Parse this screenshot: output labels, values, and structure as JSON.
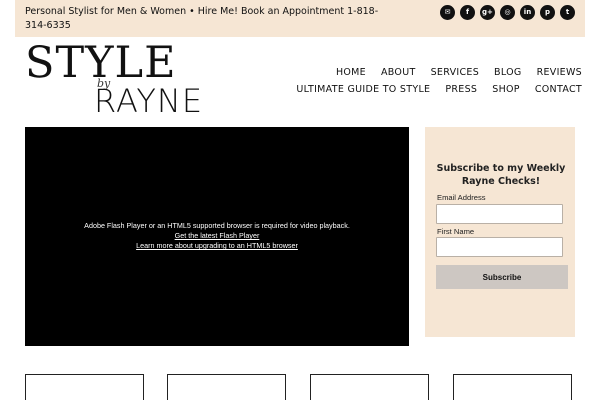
{
  "topbar": {
    "text": "Personal Stylist for Men & Women • Hire Me! Book an Appointment 1-818-314-6335",
    "social": [
      {
        "icon": "email-icon",
        "glyph": "✉"
      },
      {
        "icon": "facebook-icon",
        "glyph": "f"
      },
      {
        "icon": "google-plus-icon",
        "glyph": "g+"
      },
      {
        "icon": "instagram-icon",
        "glyph": "◎"
      },
      {
        "icon": "linkedin-icon",
        "glyph": "in"
      },
      {
        "icon": "pinterest-icon",
        "glyph": "p"
      },
      {
        "icon": "twitter-icon",
        "glyph": "t"
      }
    ]
  },
  "logo": {
    "line1": "STYLE",
    "line2": "by",
    "line3": "RAYNE"
  },
  "nav": {
    "row1": [
      "HOME",
      "ABOUT",
      "SERVICES",
      "BLOG",
      "REVIEWS"
    ],
    "row2": [
      "ULTIMATE GUIDE TO STYLE",
      "PRESS",
      "SHOP",
      "CONTACT"
    ]
  },
  "video": {
    "message": "Adobe Flash Player or an HTML5 supported browser is required for video playback.",
    "link1": "Get the latest Flash Player",
    "link2": "Learn more about upgrading to an HTML5 browser"
  },
  "subscribe": {
    "title": "Subscribe to my Weekly Rayne Checks!",
    "email_label": "Email Address",
    "email_value": "",
    "name_label": "First Name",
    "name_value": "",
    "button": "Subscribe"
  },
  "colors": {
    "accent_beige": "#f6e6d4",
    "button_gray": "#cdc7c2"
  }
}
